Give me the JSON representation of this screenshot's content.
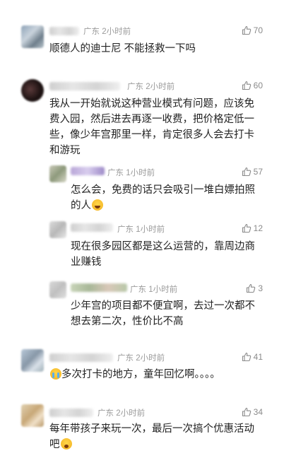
{
  "comments": [
    {
      "location": "广东",
      "time": "2小时前",
      "likes": "70",
      "text": "顺德人的迪士尼 不能拯救一下吗"
    },
    {
      "location": "广东",
      "time": "2小时前",
      "likes": "60",
      "text": "我从一开始就说这种营业模式有问题，应该免费入园，然后进去再逐一收费，把价格定低一些，像少年宫那里一样，肯定很多人会去打卡和游玩"
    },
    {
      "location": "广东",
      "time": "1小时前",
      "likes": "57",
      "text": "怎么会，免费的话只会吸引一堆白嫖拍照的人",
      "emoji": "laugh-emoji"
    },
    {
      "location": "广东",
      "time": "1小时前",
      "likes": "12",
      "text": "现在很多园区都是这么运营的，靠周边商业赚钱"
    },
    {
      "location": "广东",
      "time": "1小时前",
      "likes": "3",
      "text": "少年宫的项目都不便宜啊，去过一次都不想去第二次，性价比不高"
    },
    {
      "location": "广东",
      "time": "2小时前",
      "likes": "41",
      "text": "多次打卡的地方，童年回忆啊。。。。",
      "emoji": "crying-emoji"
    },
    {
      "location": "广东",
      "time": "2小时前",
      "likes": "34",
      "text": "每年带孩子来玩一次，最后一次搞个优惠活动吧",
      "emoji": "shocked-emoji"
    }
  ],
  "colors": {
    "meta_text": "#9a9a9a",
    "body_text": "#222222",
    "like_icon": "#8a8a8a"
  }
}
